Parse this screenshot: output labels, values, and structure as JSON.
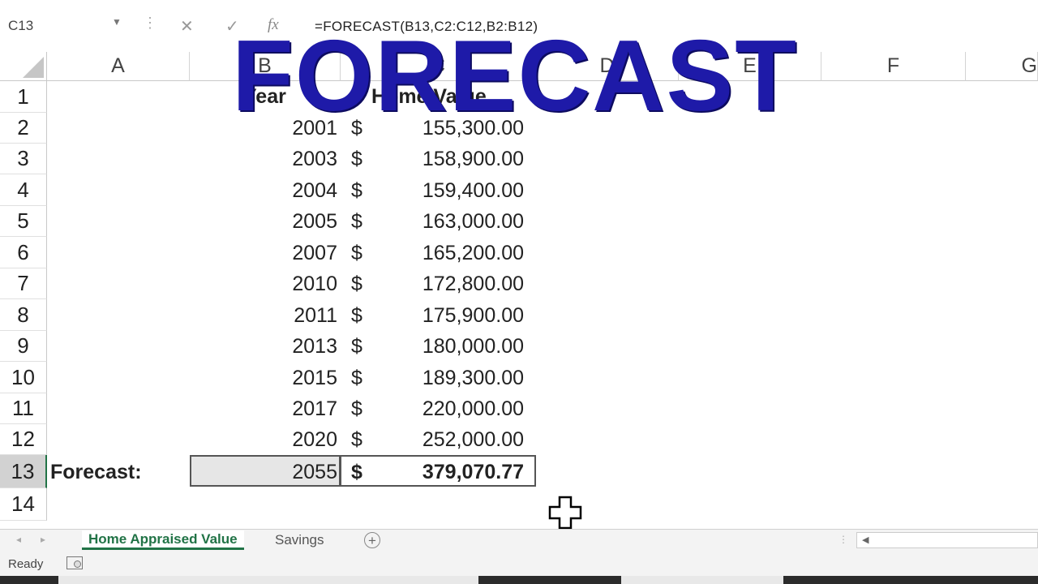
{
  "formula_bar": {
    "name_box": "C13",
    "fx_label": "fx",
    "formula": "=FORECAST(B13,C2:C12,B2:B12)"
  },
  "columns": [
    "A",
    "B",
    "C",
    "D",
    "E",
    "F",
    "G"
  ],
  "rows": [
    "1",
    "2",
    "3",
    "4",
    "5",
    "6",
    "7",
    "8",
    "9",
    "10",
    "11",
    "12",
    "13",
    "14"
  ],
  "headers": {
    "b1": "Year",
    "c1": "Home Value"
  },
  "data_rows": [
    {
      "year": "2001",
      "cur": "$",
      "value": "155,300.00"
    },
    {
      "year": "2003",
      "cur": "$",
      "value": "158,900.00"
    },
    {
      "year": "2004",
      "cur": "$",
      "value": "159,400.00"
    },
    {
      "year": "2005",
      "cur": "$",
      "value": "163,000.00"
    },
    {
      "year": "2007",
      "cur": "$",
      "value": "165,200.00"
    },
    {
      "year": "2010",
      "cur": "$",
      "value": "172,800.00"
    },
    {
      "year": "2011",
      "cur": "$",
      "value": "175,900.00"
    },
    {
      "year": "2013",
      "cur": "$",
      "value": "180,000.00"
    },
    {
      "year": "2015",
      "cur": "$",
      "value": "189,300.00"
    },
    {
      "year": "2017",
      "cur": "$",
      "value": "220,000.00"
    },
    {
      "year": "2020",
      "cur": "$",
      "value": "252,000.00"
    }
  ],
  "forecast_row": {
    "label": "Forecast:",
    "year": "2055",
    "cur": "$",
    "value": "379,070.77"
  },
  "overlay_title": "FORECAST",
  "sheet_tabs": {
    "active": "Home Appraised Value",
    "other": "Savings",
    "add": "+"
  },
  "status": {
    "text": "Ready"
  },
  "colors": {
    "overlay": "#1e1aa8",
    "excel_green": "#217346"
  }
}
